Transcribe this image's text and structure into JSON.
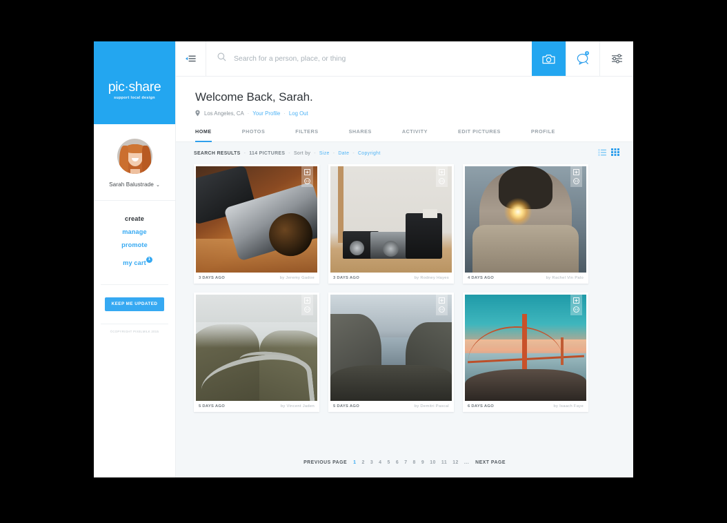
{
  "sidebar": {
    "logo": {
      "wordmark": "pic·share",
      "tagline": "support local design"
    },
    "profile": {
      "name": "Sarah Balustrade",
      "chevron": "⌄"
    },
    "nav": [
      {
        "label": "create",
        "state": "active"
      },
      {
        "label": "manage",
        "state": "link"
      },
      {
        "label": "promote",
        "state": "link"
      },
      {
        "label": "my cart",
        "state": "link",
        "badge": "1"
      }
    ],
    "cta_label": "KEEP ME UPDATED",
    "copyright": "©COPYRIGHT PIXELMILK 2015"
  },
  "topbar": {
    "collapse_icon": "collapse-menu-icon",
    "search": {
      "placeholder": "Search for a person, place, or thing",
      "value": "",
      "icon": "search-icon"
    },
    "camera_icon": "camera-icon",
    "chat_icon": "chat-bubble-icon",
    "chat_badge": "3",
    "settings_icon": "sliders-icon"
  },
  "welcome": {
    "title": "Welcome Back, Sarah.",
    "location": "Los Angeles, CA",
    "sep": "·",
    "profile_link": "Your Profile",
    "logout_link": "Log Out"
  },
  "tabs": [
    {
      "label": "HOME",
      "active": true
    },
    {
      "label": "PHOTOS",
      "active": false
    },
    {
      "label": "FILTERS",
      "active": false
    },
    {
      "label": "SHARES",
      "active": false
    },
    {
      "label": "ACTIVITY",
      "active": false
    },
    {
      "label": "EDIT PICTURES",
      "active": false
    },
    {
      "label": "PROFILE",
      "active": false
    }
  ],
  "results": {
    "label": "SEARCH RESULTS",
    "count": "114 PICTURES",
    "sort_label": "Sort by",
    "sep": "-",
    "sort_options": [
      "Size",
      "Date",
      "Copyright"
    ],
    "view_list_icon": "list-view-icon",
    "view_grid_icon": "grid-view-icon",
    "active_view": "grid"
  },
  "photos": [
    {
      "art": "ph-lens",
      "date": "3 DAYS AGO",
      "author": "by Jeremy Gadoe",
      "subject": "minolta-camera-lens"
    },
    {
      "art": "ph-cams",
      "date": "3 DAYS AGO",
      "author": "by Rodney Hayes",
      "subject": "vintage-cameras"
    },
    {
      "art": "ph-spark",
      "date": "4 DAYS AGO",
      "author": "by Rachel Vin Palo",
      "subject": "woman-with-sparkler"
    },
    {
      "art": "ph-road",
      "date": "5 DAYS AGO",
      "author": "by Vincent Jaden",
      "subject": "winding-mountain-road"
    },
    {
      "art": "ph-fjord",
      "date": "5 DAYS AGO",
      "author": "by Demitri Pascal",
      "subject": "fjord-cliff-overlook"
    },
    {
      "art": "ph-gg",
      "date": "6 DAYS AGO",
      "author": "by Isaach Faye",
      "subject": "golden-gate-bridge"
    }
  ],
  "photo_actions": {
    "add_icon": "add-to-collection-icon",
    "share_icon": "share-circle-icon"
  },
  "pagination": {
    "previous": "PREVIOUS PAGE",
    "next": "NEXT PAGE",
    "pages": [
      "1",
      "2",
      "3",
      "4",
      "5",
      "6",
      "7",
      "8",
      "9",
      "10",
      "11",
      "12"
    ],
    "ellipsis": "...",
    "current": "1"
  },
  "colors": {
    "brand_blue": "#23a6f0",
    "link_blue": "#36a9f2",
    "page_bg": "#000000",
    "content_bg": "#f4f7f9",
    "text_dark": "#2f3439",
    "text_muted": "#9aa3aa"
  }
}
